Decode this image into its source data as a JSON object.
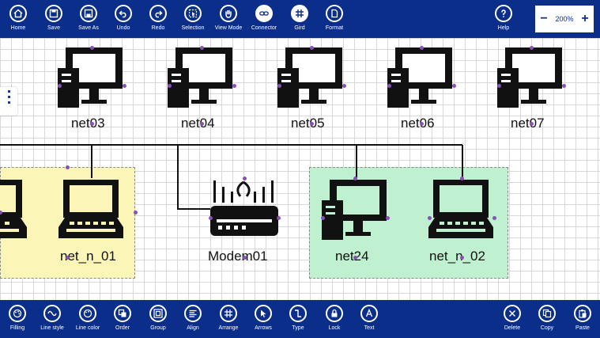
{
  "toolbar_top": [
    {
      "id": "home",
      "label": "Home",
      "icon": "home-icon"
    },
    {
      "id": "save",
      "label": "Save",
      "icon": "save-icon"
    },
    {
      "id": "saveas",
      "label": "Save As",
      "icon": "save-as-icon"
    },
    {
      "id": "undo",
      "label": "Undo",
      "icon": "undo-icon"
    },
    {
      "id": "redo",
      "label": "Redo",
      "icon": "redo-icon"
    },
    {
      "id": "selection",
      "label": "Selection",
      "icon": "selection-icon"
    },
    {
      "id": "viewmode",
      "label": "View Mode",
      "icon": "hand-icon"
    },
    {
      "id": "connector",
      "label": "Connector",
      "icon": "link-icon"
    },
    {
      "id": "gird",
      "label": "Gird",
      "icon": "grid-icon"
    },
    {
      "id": "format",
      "label": "Format",
      "icon": "format-icon"
    },
    {
      "id": "help",
      "label": "Help",
      "icon": "help-icon"
    }
  ],
  "zoom": {
    "minus": "−",
    "value": "200%",
    "plus": "+"
  },
  "toolbar_bottom": [
    {
      "id": "filling",
      "label": "Filling",
      "icon": "palette-icon"
    },
    {
      "id": "linestyle",
      "label": "Line style",
      "icon": "wave-icon"
    },
    {
      "id": "linecolor",
      "label": "Line color",
      "icon": "palette-icon"
    },
    {
      "id": "order",
      "label": "Order",
      "icon": "order-icon"
    },
    {
      "id": "group",
      "label": "Group",
      "icon": "group-icon"
    },
    {
      "id": "align",
      "label": "Align",
      "icon": "align-icon"
    },
    {
      "id": "arrange",
      "label": "Arrange",
      "icon": "grid-icon"
    },
    {
      "id": "arrows",
      "label": "Arrows",
      "icon": "cursor-icon"
    },
    {
      "id": "type",
      "label": "Type",
      "icon": "connector-type-icon"
    },
    {
      "id": "lock",
      "label": "Lock",
      "icon": "lock-icon"
    },
    {
      "id": "text",
      "label": "Text",
      "icon": "text-icon"
    },
    {
      "id": "delete",
      "label": "Delete",
      "icon": "delete-icon"
    },
    {
      "id": "copy",
      "label": "Copy",
      "icon": "copy-icon"
    },
    {
      "id": "paste",
      "label": "Paste",
      "icon": "paste-icon"
    }
  ],
  "diagram": {
    "nodes": [
      {
        "id": "net03",
        "label": "net03",
        "kind": "desktop"
      },
      {
        "id": "net04",
        "label": "net04",
        "kind": "desktop"
      },
      {
        "id": "net05",
        "label": "net05",
        "kind": "desktop"
      },
      {
        "id": "net06",
        "label": "net06",
        "kind": "desktop"
      },
      {
        "id": "net07",
        "label": "net07",
        "kind": "desktop"
      },
      {
        "id": "net_n_01",
        "label": "net_n_01",
        "kind": "laptop"
      },
      {
        "id": "modem01",
        "label": "Modem01",
        "kind": "router"
      },
      {
        "id": "net24",
        "label": "net24",
        "kind": "desktop"
      },
      {
        "id": "net_n_02",
        "label": "net_n_02",
        "kind": "laptop"
      }
    ],
    "colors": {
      "group_yellow": "#fbf6b8",
      "group_green": "#bff0cf",
      "handle": "#8a4fb8",
      "wire": "#111111",
      "bar": "#0a2e8a"
    }
  }
}
